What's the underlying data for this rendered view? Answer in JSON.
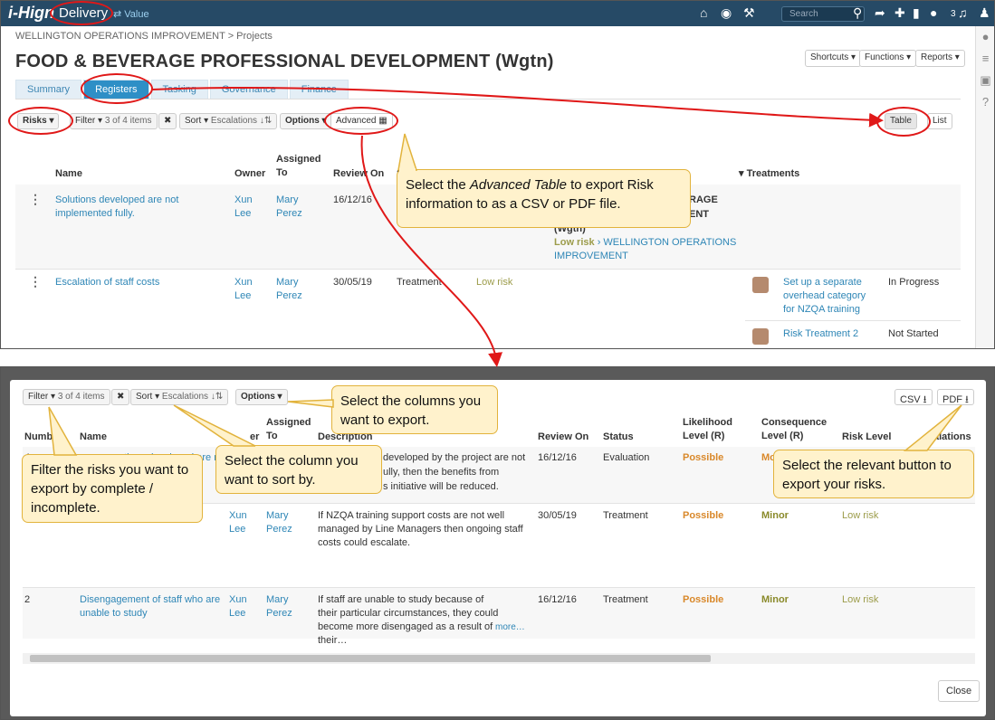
{
  "nav": {
    "logo": "i-Hign",
    "delivery": "Delivery",
    "value": "⇄ Value",
    "search_placeholder": "Search",
    "notif_count": "3"
  },
  "breadcrumb": "WELLINGTON OPERATIONS IMPROVEMENT > Projects",
  "page_title": "FOOD & BEVERAGE PROFESSIONAL DEVELOPMENT (Wgtn)",
  "header_buttons": {
    "shortcuts": "Shortcuts ▾",
    "functions": "Functions ▾",
    "reports": "Reports ▾"
  },
  "tabs": [
    "Summary",
    "Registers",
    "Tasking",
    "Governance",
    "Finance"
  ],
  "toolbar": {
    "risks": "Risks ▾",
    "filter": "Filter ▾",
    "filter_count": "3 of 4 items",
    "clear": "✖",
    "sort": "Sort ▾",
    "sort_field": "Escalations ↓⇅",
    "options": "Options ▾",
    "advanced": "Advanced ▦",
    "table": "Table",
    "list": "List"
  },
  "top_table": {
    "headers": {
      "name": "Name",
      "owner": "Owner",
      "assigned": "Assigned To",
      "review": "Review On",
      "status": "S",
      "treatments": "▾ Treatments"
    },
    "rows": [
      {
        "name": "Solutions developed are not implemented fully.",
        "owner": "Xun Lee",
        "assigned": "Mary Perez",
        "review": "16/12/16",
        "parent_frag1": "RAGE",
        "parent_frag2": "ENT",
        "parent_frag3": "(Wgtn)",
        "risk_level": "Low risk",
        "parent_link": "› WELLINGTON OPERATIONS IMPROVEMENT"
      },
      {
        "name": "Escalation of staff costs",
        "owner": "Xun Lee",
        "assigned": "Mary Perez",
        "review": "30/05/19",
        "status": "Treatment",
        "risk_level": "Low risk",
        "treatments": [
          {
            "name": "Set up a separate overhead category for NZQA training",
            "status": "In Progress"
          },
          {
            "name": "Risk Treatment 2",
            "status": "Not Started"
          }
        ]
      }
    ]
  },
  "modal": {
    "toolbar": {
      "filter": "Filter ▾",
      "filter_count": "3 of 4 items",
      "clear": "✖",
      "sort": "Sort ▾",
      "sort_field": "Escalations ↓⇅",
      "options": "Options ▾",
      "csv": "CSV ⭳",
      "pdf": "PDF ⭳"
    },
    "headers": {
      "number": "Numb",
      "name": "Name",
      "owner": "er",
      "assigned": "Assigned To",
      "description": "Description",
      "review": "Review On",
      "status": "Status",
      "likelihood": "Likelihood Level (R)",
      "consequence": "Consequence Level (R)",
      "risk_level": "Risk Level",
      "escalations": "alations"
    },
    "rows": [
      {
        "number": "4",
        "name": "utions developed are not",
        "description_1": "developed by the project are not",
        "description_2": "ully, then the benefits from",
        "description_3": "s initiative will be reduced.",
        "review": "16/12/16",
        "status": "Evaluation",
        "likelihood": "Possible",
        "consequence": "Mo"
      },
      {
        "number": "",
        "name": "",
        "owner": "Xun Lee",
        "assigned": "Mary Perez",
        "description": "If NZQA training support costs are not well managed by Line Managers then ongoing staff costs could escalate.",
        "review": "30/05/19",
        "status": "Treatment",
        "likelihood": "Possible",
        "consequence": "Minor",
        "risk_level": "Low risk"
      },
      {
        "number": "2",
        "name": "Disengagement of staff who are unable to study",
        "owner": "Xun Lee",
        "assigned": "Mary Perez",
        "description": "If staff are unable to study because of their particular circumstances, they could become more disengaged as a result of their…",
        "more": "more…",
        "review": "16/12/16",
        "status": "Treatment",
        "likelihood": "Possible",
        "consequence": "Minor",
        "risk_level": "Low risk"
      }
    ],
    "close": "Close"
  },
  "callouts": {
    "advanced_pre": "Select the ",
    "advanced_em": "Advanced Table",
    "advanced_post": " to export Risk information to as a CSV or PDF file.",
    "columns": "Select the columns you want to export.",
    "sort": "Select the column you want to sort by.",
    "filter": "Filter the risks you want to export by complete / incomplete.",
    "export": "Select the relevant button to export your risks."
  },
  "colors": {
    "navbar": "#264a66",
    "accent": "#2e8fc6",
    "highlight": "#e01818",
    "callout_bg": "#fff2cc",
    "callout_border": "#e2b33c"
  }
}
